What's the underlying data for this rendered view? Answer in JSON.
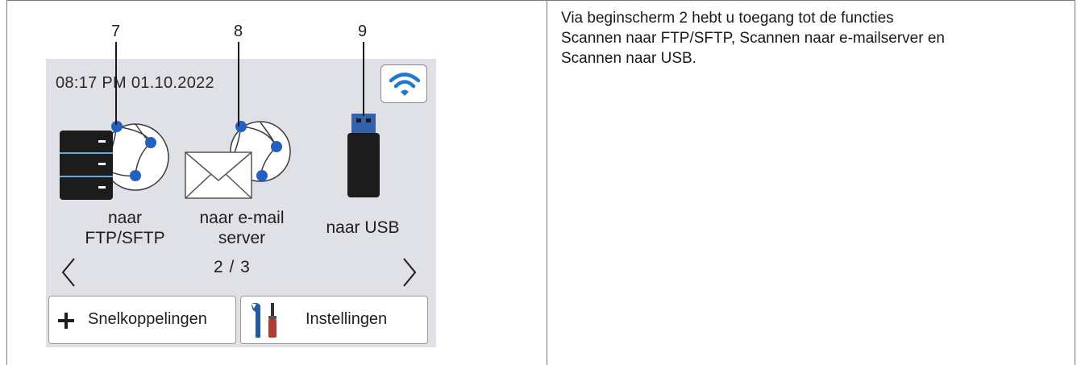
{
  "screen": {
    "datetime": "08:17 PM 01.10.2022",
    "callouts": [
      "7",
      "8",
      "9"
    ],
    "functions": [
      {
        "label_line1": "naar",
        "label_line2": "FTP/SFTP",
        "icon": "ftp-server-globe-icon"
      },
      {
        "label_line1": "naar e-mail",
        "label_line2": "server",
        "icon": "email-server-globe-icon"
      },
      {
        "label_line1": "naar USB",
        "label_line2": "",
        "icon": "usb-drive-icon"
      }
    ],
    "page_indicator": "2 / 3",
    "shortcuts_label": "Snelkoppelingen",
    "settings_label": "Instellingen"
  },
  "description": {
    "line1": "Via beginscherm 2 hebt u toegang tot de functies",
    "line2": "Scannen naar FTP/SFTP, Scannen naar e-mailserver en",
    "line3": "Scannen naar USB."
  },
  "colors": {
    "screen_bg": "#e0e0e7",
    "accent_blue": "#2360c4",
    "wifi_blue": "#1f78d1"
  }
}
